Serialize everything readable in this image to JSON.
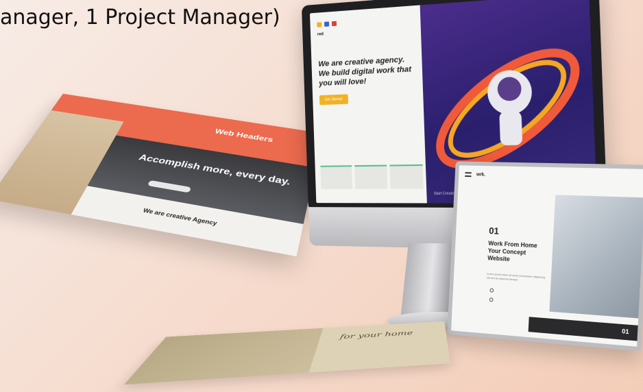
{
  "headline": "anager, 1 Project Manager)",
  "monitor": {
    "logo": "red",
    "heading": "We are creative agency. We build digital work that you will love!",
    "cta": "Get Started",
    "caption": "Start Creation",
    "dot_colors": [
      "#f0b323",
      "#3a63c9",
      "#d8433a"
    ]
  },
  "left_card": {
    "brand": "Web Headers",
    "hero": "Accomplish more, every day.",
    "footer": "We are creative Agency"
  },
  "right_card": {
    "logo": "wrk.",
    "number": "01",
    "title": "Work From Home Your Concept Website",
    "body": "Lorem ipsum dolor sit amet consectetur adipiscing elit sed do eiusmod tempor",
    "bar_number": "01"
  },
  "bottom_card": {
    "text": "for your home"
  }
}
